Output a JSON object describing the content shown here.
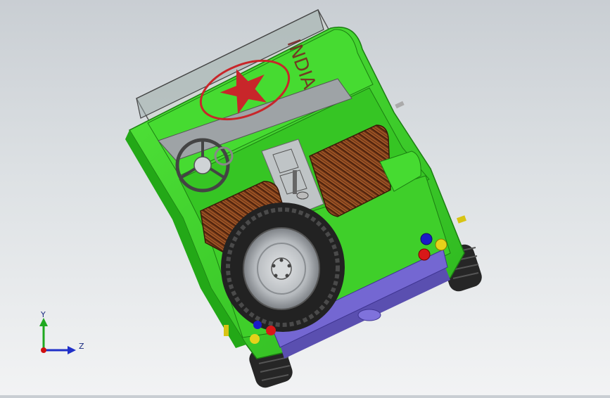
{
  "model": {
    "badge_text": "INDIA"
  },
  "triad": {
    "y_label": "Y",
    "z_label": "Z",
    "colors": {
      "y": "#1fa81f",
      "z": "#2030c8",
      "x": "#d01010"
    }
  },
  "colors": {
    "body": "#3fd62a",
    "body_dark": "#22a618",
    "seat": "#7a3a18",
    "bumper": "#6f63c8",
    "star": "#c8262a",
    "tire": "#2a2a2a",
    "rim": "#bfc3c7"
  },
  "icons": [
    "coordinate-triad-icon"
  ]
}
